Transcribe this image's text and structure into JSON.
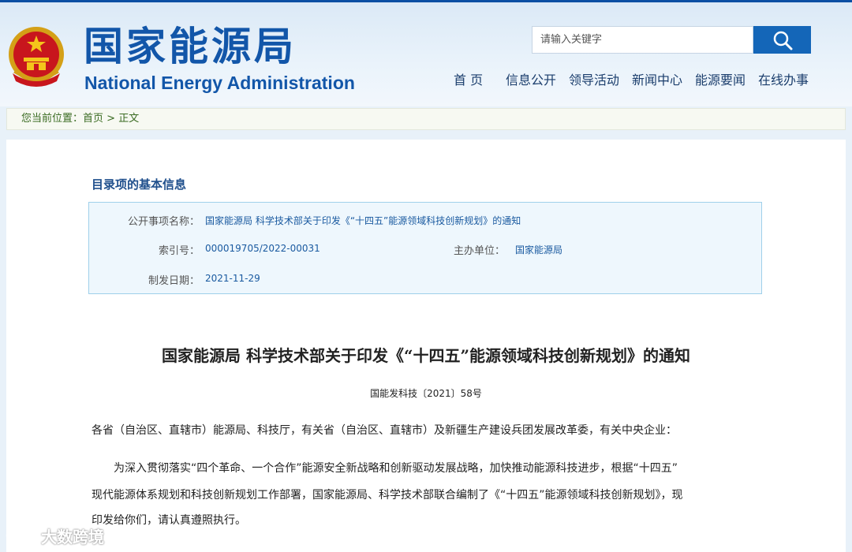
{
  "header": {
    "logo_cn": "国家能源局",
    "logo_en": "National Energy Administration",
    "search_placeholder": "请输入关键字",
    "nav": [
      "首 页",
      "信息公开",
      "领导活动",
      "新闻中心",
      "能源要闻",
      "在线办事"
    ]
  },
  "breadcrumb": {
    "prefix": "您当前位置：",
    "home": "首页",
    "separator": ">",
    "current": "正文"
  },
  "info": {
    "heading": "目录项的基本信息",
    "name_label": "公开事项名称：",
    "name_value": "国家能源局 科学技术部关于印发《“十四五”能源领域科技创新规划》的通知",
    "index_label": "索引号：",
    "index_value": "000019705/2022-00031",
    "org_label": "主办单位：",
    "org_value": "国家能源局",
    "date_label": "制发日期：",
    "date_value": "2021-11-29"
  },
  "document": {
    "title": "国家能源局 科学技术部关于印发《“十四五”能源领域科技创新规划》的通知",
    "number": "国能发科技〔2021〕58号",
    "salutation": "各省（自治区、直辖市）能源局、科技厅，有关省（自治区、直辖市）及新疆生产建设兵团发展改革委，有关中央企业：",
    "body_line1": "为深入贯彻落实“四个革命、一个合作”能源安全新战略和创新驱动发展战略，加快推动能源科技进步，根据“十四五”",
    "body_line2": "现代能源体系规划和科技创新规划工作部署，国家能源局、科学技术部联合编制了《“十四五”能源领域科技创新规划》，现",
    "body_line3": "印发给你们，请认真遵照执行。"
  },
  "watermark": {
    "text": "大数跨境"
  },
  "colors": {
    "brand_blue": "#1256a9",
    "search_button": "#1466b8",
    "breadcrumb_green": "#3a6b22",
    "link_blue": "#1a5aa0"
  }
}
